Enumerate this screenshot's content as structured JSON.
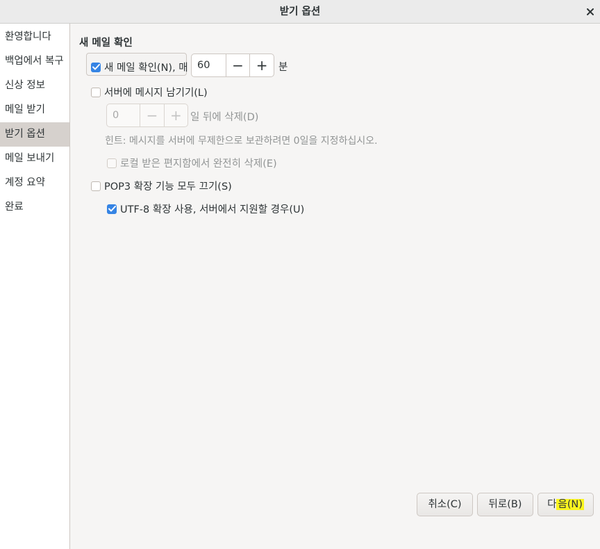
{
  "window": {
    "title": "받기 옵션"
  },
  "sidebar": {
    "items": [
      {
        "label": "환영합니다"
      },
      {
        "label": "백업에서 복구"
      },
      {
        "label": "신상 정보"
      },
      {
        "label": "메일 받기"
      },
      {
        "label": "받기 옵션",
        "selected": true
      },
      {
        "label": "메일 보내기"
      },
      {
        "label": "계정 요약"
      },
      {
        "label": "완료"
      }
    ]
  },
  "main": {
    "section_title": "새 메일 확인",
    "check_new_mail": {
      "label": "새 메일 확인(N), 매",
      "checked": true
    },
    "interval": {
      "value": "60",
      "minus": "−",
      "plus": "+",
      "unit": "분"
    },
    "leave_on_server": {
      "label": "서버에 메시지 남기기(L)",
      "checked": false
    },
    "delete_after": {
      "value": "0",
      "minus": "−",
      "plus": "+",
      "suffix": "일 뒤에 삭제(D)"
    },
    "hint": "힌트: 메시지를 서버에 무제한으로 보관하려면 0일을 지정하십시오.",
    "delete_local": {
      "label": "로컬 받은 편지함에서 완전히 삭제(E)",
      "checked": false
    },
    "disable_pop3": {
      "label": "POP3 확장 기능 모두 끄기(S)",
      "checked": false
    },
    "utf8": {
      "label": "UTF-8 확장 사용, 서버에서 지원할 경우(U)",
      "checked": true
    }
  },
  "buttons": {
    "cancel": "취소(C)",
    "back": "뒤로(B)",
    "next_prefix": "다",
    "next_highlight": "음(N)"
  },
  "colors": {
    "accent": "#3584e4",
    "highlight": "#faf51f",
    "selected_bg": "#d6d1cd"
  }
}
